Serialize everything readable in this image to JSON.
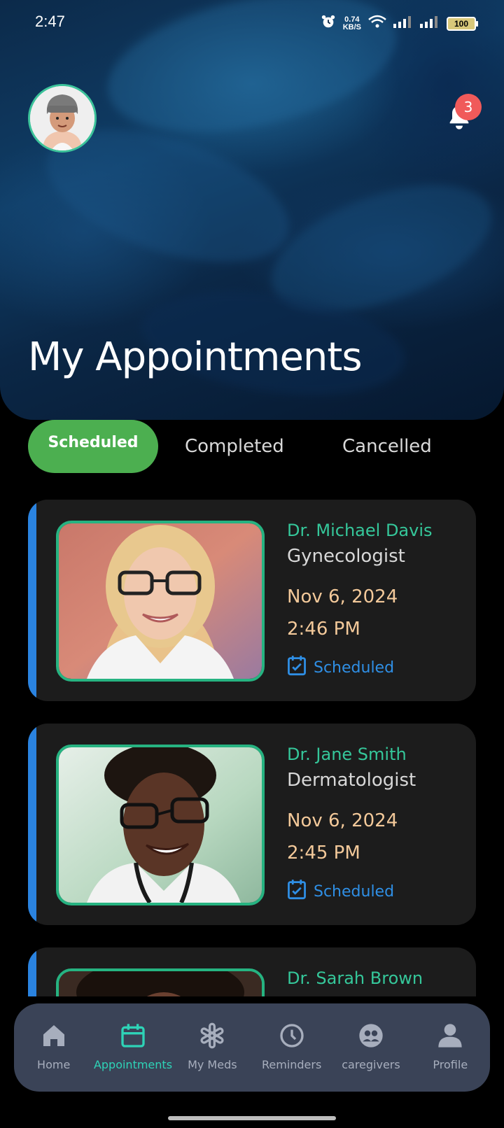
{
  "status_bar": {
    "time": "2:47",
    "net_speed_value": "0.74",
    "net_speed_unit": "KB/S",
    "battery": "100"
  },
  "header": {
    "notification_count": "3",
    "title": "My Appointments"
  },
  "tabs": [
    {
      "label": "Scheduled",
      "active": true
    },
    {
      "label": "Completed",
      "active": false
    },
    {
      "label": "Cancelled",
      "active": false
    }
  ],
  "appointments": [
    {
      "doctor": "Dr. Michael Davis",
      "specialty": "Gynecologist",
      "date": "Nov 6, 2024",
      "time": "2:46 PM",
      "status": "Scheduled"
    },
    {
      "doctor": "Dr. Jane Smith",
      "specialty": "Dermatologist",
      "date": "Nov 6, 2024",
      "time": "2:45 PM",
      "status": "Scheduled"
    },
    {
      "doctor": "Dr. Sarah Brown",
      "specialty": "",
      "date": "",
      "time": "",
      "status": ""
    }
  ],
  "bottom_nav": [
    {
      "label": "Home",
      "icon": "home-icon"
    },
    {
      "label": "Appointments",
      "icon": "calendar-icon"
    },
    {
      "label": "My Meds",
      "icon": "medical-icon"
    },
    {
      "label": "Reminders",
      "icon": "clock-icon"
    },
    {
      "label": "caregivers",
      "icon": "caregivers-icon"
    },
    {
      "label": "Profile",
      "icon": "profile-icon"
    }
  ],
  "colors": {
    "accent": "#4caf50",
    "doctor_name": "#35c79a",
    "date_time": "#f3c99a",
    "status": "#2f8fe5",
    "nav_active": "#2ed3b7",
    "badge": "#f05a5a"
  }
}
